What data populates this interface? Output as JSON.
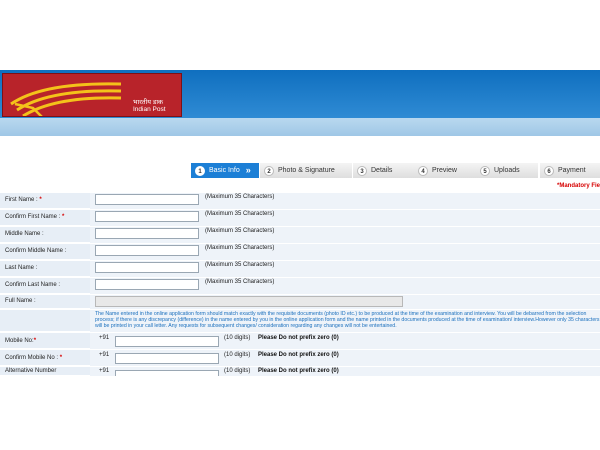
{
  "logo": {
    "hindi": "भारतीय डाक",
    "english": "Indian Post"
  },
  "steps": [
    {
      "num": "1",
      "label": "Basic Info",
      "active": true
    },
    {
      "num": "2",
      "label": "Photo & Signature"
    },
    {
      "num": "3",
      "label": "Details"
    },
    {
      "num": "4",
      "label": "Preview"
    },
    {
      "num": "5",
      "label": "Uploads"
    },
    {
      "num": "6",
      "label": "Payment"
    }
  ],
  "mandatory_note": "*Mandatory Fie",
  "form": {
    "fields": [
      {
        "label": "First Name :",
        "required": "*",
        "hint": "(Maximum 35 Characters)"
      },
      {
        "label": "Confirm First Name :",
        "required": "*",
        "hint": "(Maximum 35 Characters)"
      },
      {
        "label": "Middle Name :",
        "required": "",
        "hint": "(Maximum 35 Characters)"
      },
      {
        "label": "Confirm Middle Name :",
        "required": "",
        "hint": "(Maximum 35 Characters)"
      },
      {
        "label": "Last Name :",
        "required": "",
        "hint": "(Maximum 35 Characters)"
      },
      {
        "label": "Confirm Last Name :",
        "required": "",
        "hint": "(Maximum 35 Characters)"
      }
    ],
    "full_name_label": "Full Name :",
    "note": "The Name entered in the online application form should match exactly with the requisite documents (photo ID etc.) to be produced at the time of the examination and interview. You will be debarred from the selection process; if there is any discrepancy (difference) in the name entered by you in the online application form and the name printed in the documents produced at the time of examination/ interview.However only 35 characters will be printed in your call letter. Any requests for subsequent changes/ consideration regarding any changes will not be entertained.",
    "phones": [
      {
        "label": "Mobile No:",
        "required": "*",
        "prefix": "+91",
        "digits": "(10 digits)",
        "warning": "Please Do not prefix zero (0)"
      },
      {
        "label": "Confirm Mobile No :",
        "required": "*",
        "prefix": "+91",
        "digits": "(10 digits)",
        "warning": "Please Do not prefix zero (0)"
      },
      {
        "label": "Alternative Number",
        "required": "",
        "prefix": "+91",
        "digits": "(10 digits)",
        "warning": "Please Do not prefix zero (0)"
      }
    ]
  },
  "colors": {
    "header_blue": "#1c7fd6",
    "logo_red": "#b8232a",
    "logo_yellow": "#f4c21a",
    "note_blue": "#1a6fbd",
    "required_red": "#d60000"
  }
}
